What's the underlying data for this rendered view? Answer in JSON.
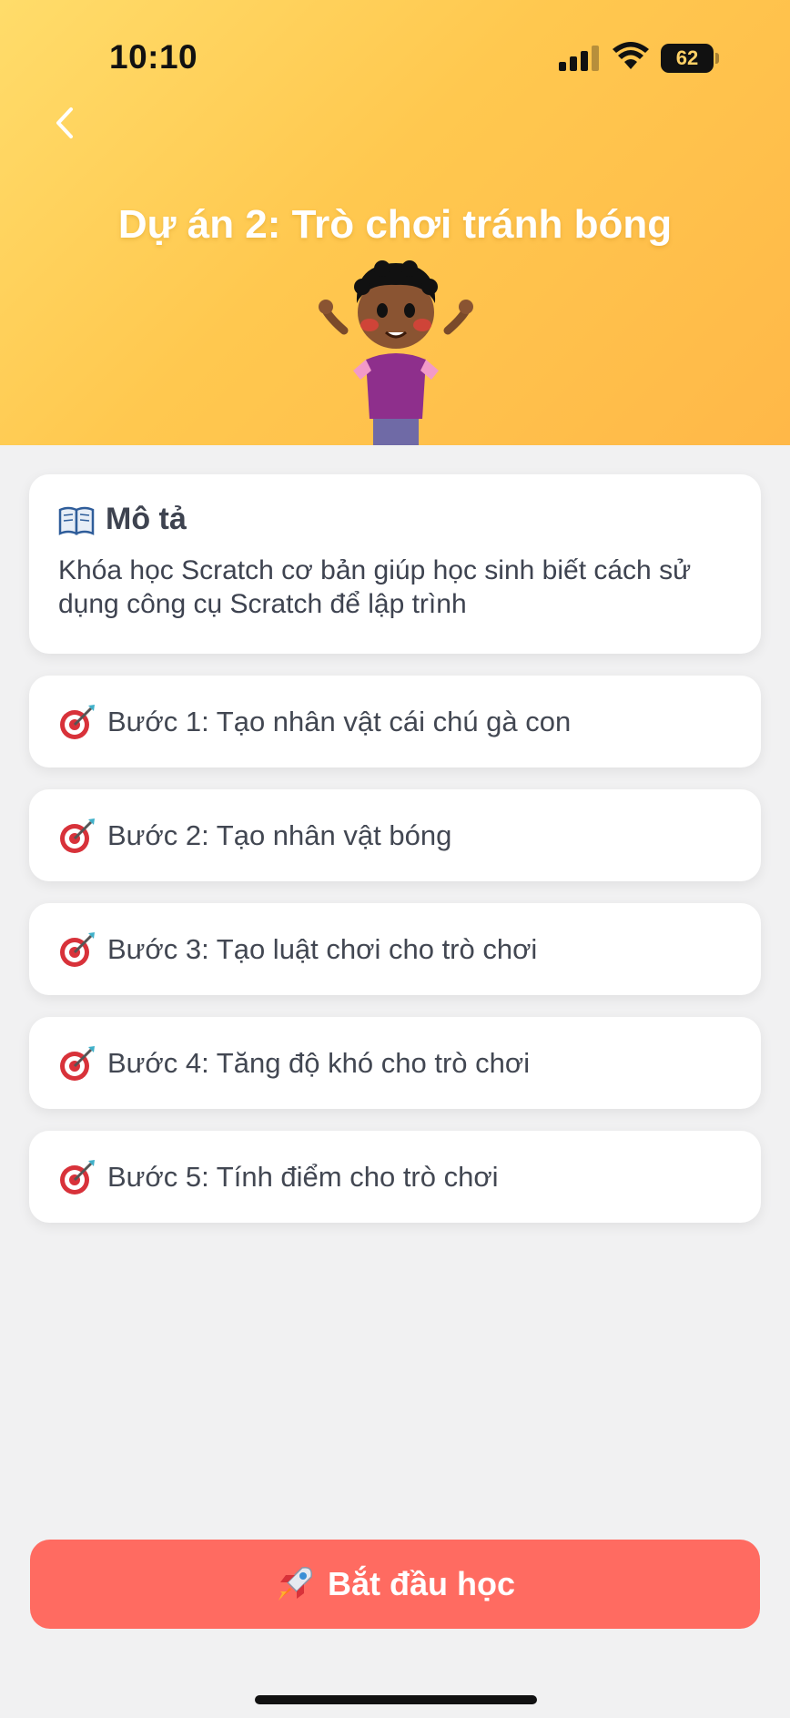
{
  "status_bar": {
    "time": "10:10",
    "battery": "62"
  },
  "header": {
    "title": "Dự án 2: Trò chơi tránh bóng"
  },
  "description": {
    "title": "Mô tả",
    "text": "Khóa học Scratch cơ bản giúp học sinh biết cách sử dụng công cụ Scratch để lập trình"
  },
  "steps": [
    {
      "label": "Bước 1: Tạo nhân vật cái chú gà con"
    },
    {
      "label": "Bước 2: Tạo nhân vật bóng"
    },
    {
      "label": "Bước 3: Tạo luật chơi cho trò chơi"
    },
    {
      "label": "Bước 4: Tăng độ khó cho trò chơi"
    },
    {
      "label": "Bước 5: Tính điểm cho trò chơi"
    }
  ],
  "start_button": {
    "label": "Bắt đầu học"
  },
  "colors": {
    "header_gradient_start": "#ffdc6a",
    "header_gradient_end": "#ffb848",
    "start_button": "#ff6b61",
    "page_background": "#f1f1f2"
  },
  "icons": {
    "back": "chevron-left-icon",
    "description": "book-icon",
    "step": "target-icon",
    "start": "rocket-icon"
  }
}
